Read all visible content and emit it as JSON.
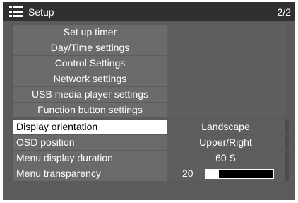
{
  "header": {
    "title": "Setup",
    "page": "2/2"
  },
  "submenus": [
    {
      "label": "Set up timer"
    },
    {
      "label": "Day/Time settings"
    },
    {
      "label": "Control Settings"
    },
    {
      "label": "Network settings"
    },
    {
      "label": "USB media player settings"
    },
    {
      "label": "Function button settings"
    }
  ],
  "settings": {
    "display_orientation": {
      "label": "Display orientation",
      "value": "Landscape"
    },
    "osd_position": {
      "label": "OSD position",
      "value": "Upper/Right"
    },
    "menu_display_duration": {
      "label": "Menu display duration",
      "value": "60 S"
    },
    "menu_transparency": {
      "label": "Menu transparency",
      "value": "20",
      "level_fraction": 0.2
    }
  },
  "colors": {
    "panel": "#5b5b5b",
    "header": "#303030",
    "selected_row": "#ffffff"
  },
  "icons": {
    "menu": "menu-list-icon"
  }
}
